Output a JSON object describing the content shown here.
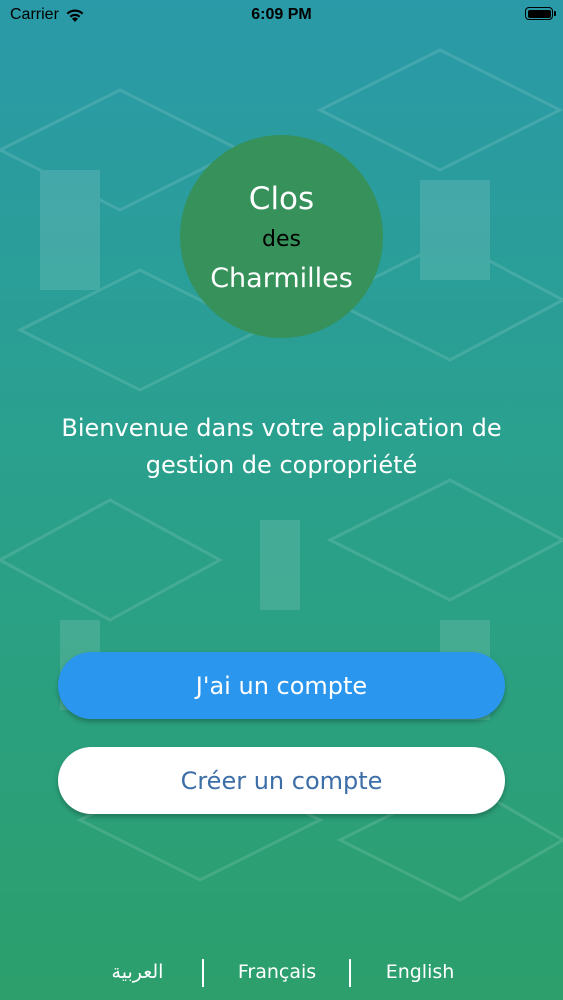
{
  "status_bar": {
    "carrier": "Carrier",
    "time": "6:09 PM",
    "icons": [
      "wifi-icon",
      "battery-icon"
    ]
  },
  "logo": {
    "line1": "Clos",
    "line2": "des",
    "line3": "Charmilles"
  },
  "welcome": {
    "text": "Bienvenue dans votre application de gestion de copropriété"
  },
  "buttons": {
    "login_label": "J'ai un compte",
    "create_label": "Créer un compte"
  },
  "languages": {
    "arabic": "العربية",
    "french": "Français",
    "english": "English"
  },
  "colors": {
    "primary_button": "#2b96ee",
    "logo_circle": "#36915a",
    "secondary_text": "#3c6ea8"
  }
}
